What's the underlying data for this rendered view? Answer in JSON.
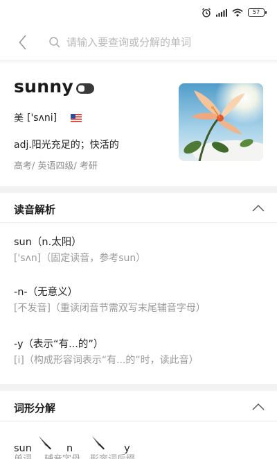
{
  "status_bar": {
    "battery": "57",
    "icons": [
      "alarm-icon",
      "signal-icon",
      "wifi-icon",
      "battery-icon"
    ]
  },
  "header": {
    "back_icon": "back-chevron-icon",
    "search_icon": "search-icon",
    "search_placeholder": "请输入要查询或分解的单词",
    "search_value": ""
  },
  "word": {
    "text": "sunny",
    "region": "美",
    "phonetic": "['sʌni]",
    "flag_icon": "us-flag-icon",
    "definition": "adj.阳光充足的；快活的",
    "tags": "高考/ 英语四级/ 考研"
  },
  "pronunciation": {
    "title": "读音解析",
    "entries": [
      {
        "main": "sun（n.太阳）",
        "sub": "['sʌn]（固定读音，参考sun）"
      },
      {
        "main": "-n-（无意义）",
        "sub": "[不发音]（重读闭音节需双写末尾辅音字母）"
      },
      {
        "main": "-y（表示“有...的”）",
        "sub": "[i]（构成形容词表示“有...的”时，读此音）"
      }
    ]
  },
  "morphology": {
    "title": "词形分解",
    "parts": [
      "sun",
      "n",
      "y"
    ],
    "labels": [
      "单词",
      "辅音字母",
      "形容词后缀"
    ],
    "separator_icon": "knife-icon"
  },
  "colors": {
    "divider": "#f2f2f2",
    "muted_text": "#9a9a9a",
    "primary_text": "#222222"
  }
}
